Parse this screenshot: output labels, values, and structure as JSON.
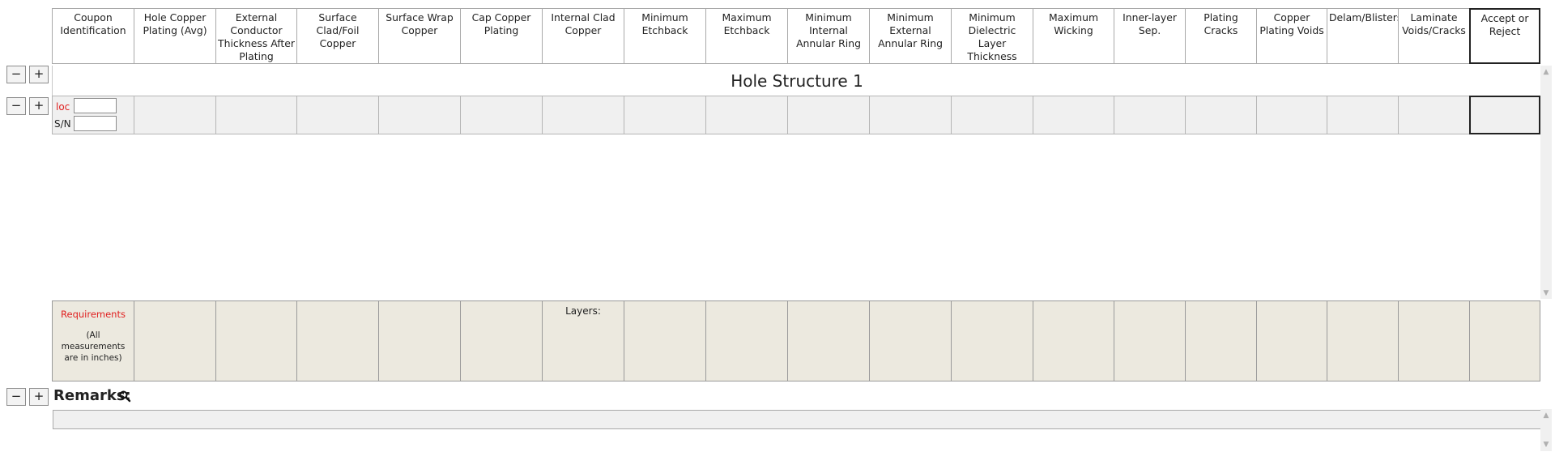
{
  "columns": [
    "Coupon Identification",
    "Hole Copper Plating (Avg)",
    "External Conductor Thickness After Plating",
    "Surface Clad/Foil Copper",
    "Surface Wrap Copper",
    "Cap Copper Plating",
    "Internal Clad Copper",
    "Minimum Etchback",
    "Maximum Etchback",
    "Minimum Internal Annular Ring",
    "Minimum External Annular Ring",
    "Minimum Dielectric Layer Thickness",
    "Maximum Wicking",
    "Inner-layer Sep.",
    "Plating Cracks",
    "Copper Plating Voids",
    "Delam/Blisters",
    "Laminate Voids/Cracks",
    "Accept  or Reject"
  ],
  "section": {
    "title": "Hole Structure 1"
  },
  "row": {
    "loc_label": "loc",
    "sn_label": "S/N",
    "loc_value": "",
    "sn_value": ""
  },
  "requirements": {
    "label": "Requirements",
    "note": "(All measurements are in inches)",
    "layers_label": "Layers:"
  },
  "remarks": {
    "label": "Remarks:"
  },
  "buttons": {
    "minus": "−",
    "plus": "+"
  },
  "icons": {
    "remarks": "search-icon"
  },
  "colors": {
    "accent_red": "#e02020",
    "requirements_bg": "#ece9df",
    "row_bg": "#f0f0f0"
  }
}
